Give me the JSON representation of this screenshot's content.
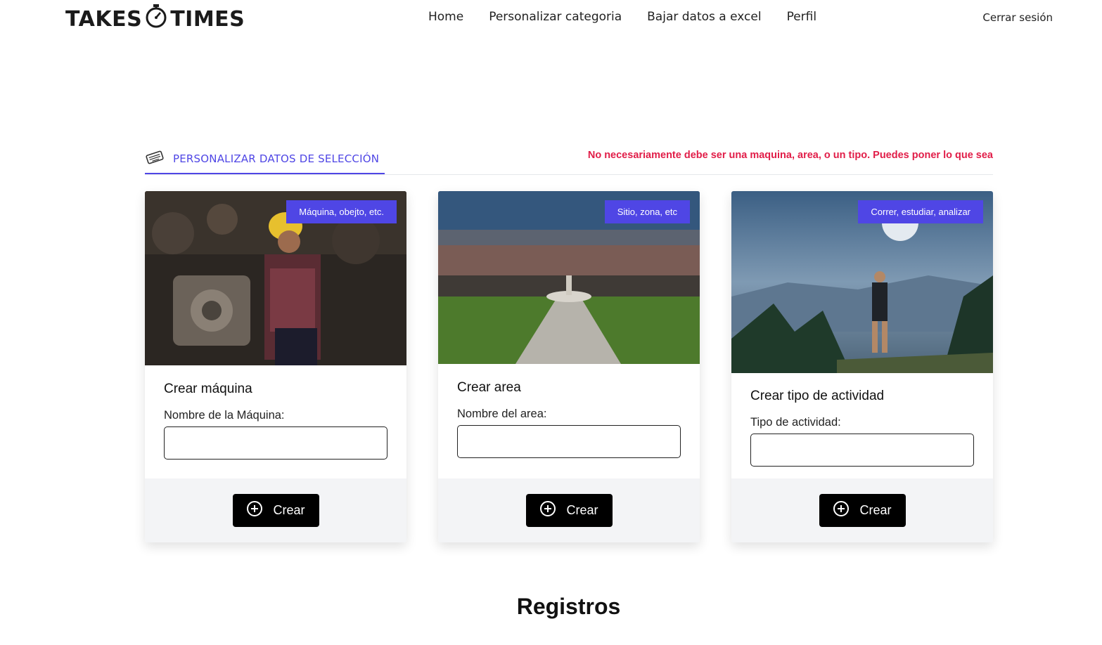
{
  "header": {
    "logo_left": "TAKES",
    "logo_right": "TIMES",
    "nav": [
      "Home",
      "Personalizar categoria",
      "Bajar datos a excel",
      "Perfil"
    ],
    "logout": "Cerrar sesión"
  },
  "section": {
    "tab_label": "PERSONALIZAR DATOS DE SELECCIÓN",
    "notice": "No necesariamente debe ser una maquina, area, o un tipo. Puedes poner lo que sea"
  },
  "cards": [
    {
      "badge": "Máquina, obejto, etc.",
      "title": "Crear máquina",
      "field_label": "Nombre de la Máquina:",
      "field_value": "",
      "button": "Crear"
    },
    {
      "badge": "Sitio, zona, etc",
      "title": "Crear area",
      "field_label": "Nombre del area:",
      "field_value": "",
      "button": "Crear"
    },
    {
      "badge": "Correr, estudiar, analizar",
      "title": "Crear tipo de actividad",
      "field_label": "Tipo de actividad:",
      "field_value": "",
      "button": "Crear"
    }
  ],
  "registros_heading": "Registros",
  "colors": {
    "accent": "#4f46e5",
    "notice": "#e11d48",
    "button": "#000000",
    "footer_bg": "#f3f4f6"
  }
}
